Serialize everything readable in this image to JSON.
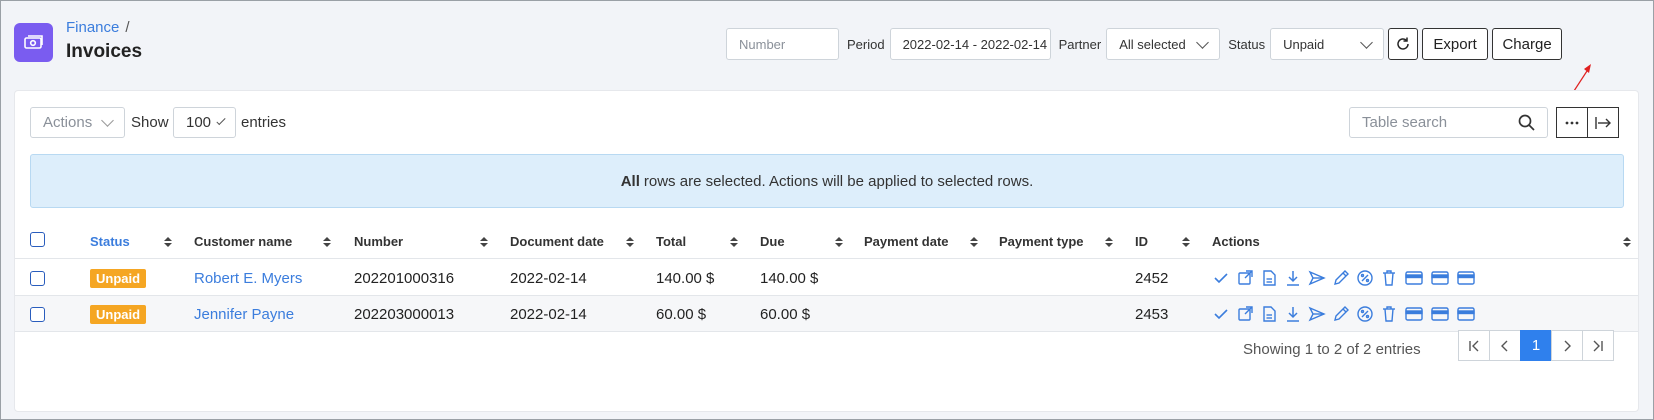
{
  "header": {
    "breadcrumb": "Finance",
    "breadcrumb_sep": "/",
    "title": "Invoices"
  },
  "filters": {
    "number_placeholder": "Number",
    "period_label": "Period",
    "period_value": "2022-02-14 - 2022-02-14",
    "partner_label": "Partner",
    "partner_value": "All selected",
    "status_label": "Status",
    "status_value": "Unpaid"
  },
  "buttons": {
    "export": "Export",
    "charge": "Charge"
  },
  "list_controls": {
    "actions_label": "Actions",
    "show_label": "Show",
    "entries_value": "100",
    "entries_label": "entries",
    "search_placeholder": "Table search"
  },
  "banner": {
    "bold": "All",
    "text": "rows are selected. Actions will be applied to selected rows."
  },
  "table": {
    "columns": [
      "Status",
      "Customer name",
      "Number",
      "Document date",
      "Total",
      "Due",
      "Payment date",
      "Payment type",
      "ID",
      "Actions"
    ],
    "rows": [
      {
        "status": "Unpaid",
        "customer": "Robert E. Myers",
        "number": "202201000316",
        "doc_date": "2022-02-14",
        "total": "140.00 $",
        "due": "140.00 $",
        "payment_date": "",
        "payment_type": "",
        "id": "2452"
      },
      {
        "status": "Unpaid",
        "customer": "Jennifer Payne",
        "number": "202203000013",
        "doc_date": "2022-02-14",
        "total": "60.00 $",
        "due": "60.00 $",
        "payment_date": "",
        "payment_type": "",
        "id": "2453"
      }
    ]
  },
  "footer": {
    "showing": "Showing 1 to 2 of 2 entries",
    "current_page": "1"
  },
  "colors": {
    "accent": "#3b7ddd",
    "brand": "#7a5cf0",
    "unpaid_badge": "#f5a623",
    "annotation_arrow": "#e02020"
  },
  "icons": [
    "money-icon",
    "refresh-icon",
    "search-icon",
    "ellipsis-icon",
    "collapse-right-icon",
    "check-icon",
    "open-external-icon",
    "document-icon",
    "download-icon",
    "send-icon",
    "edit-icon",
    "discount-icon",
    "trash-icon",
    "card-icon"
  ]
}
